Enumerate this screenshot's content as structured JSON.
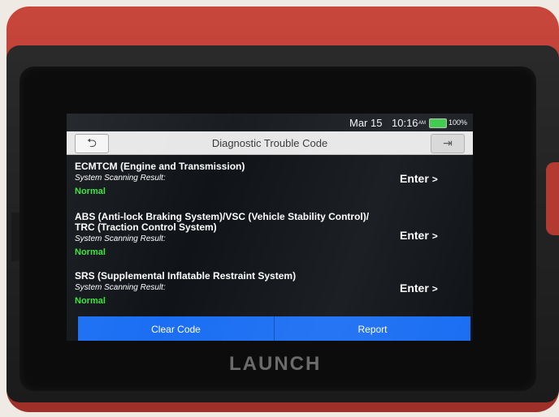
{
  "status": {
    "date": "Mar 15",
    "time": "10:16",
    "ampm": "AM",
    "battery": "100%"
  },
  "header": {
    "title": "Diagnostic Trouble Code",
    "back_icon": "back-arrow-icon",
    "exit_icon": "exit-icon"
  },
  "systems": [
    {
      "name_line1": "ECMTCM (Engine and Transmission)",
      "name_line2": "",
      "result_label": "System Scanning Result:",
      "result": "Normal",
      "enter": "Enter"
    },
    {
      "name_line1": "ABS (Anti-lock Braking System)/VSC (Vehicle Stability Control)/",
      "name_line2": "TRC (Traction Control System)",
      "result_label": "System Scanning Result:",
      "result": "Normal",
      "enter": "Enter"
    },
    {
      "name_line1": "SRS (Supplemental Inflatable Restraint System)",
      "name_line2": "",
      "result_label": "System Scanning Result:",
      "result": "Normal",
      "enter": "Enter"
    }
  ],
  "actions": {
    "clear_code": "Clear Code",
    "report": "Report"
  },
  "brand": "LAUNCH",
  "colors": {
    "accent_blue": "#1b6ef3",
    "normal_green": "#39e33a",
    "device_red": "#b33a31"
  }
}
